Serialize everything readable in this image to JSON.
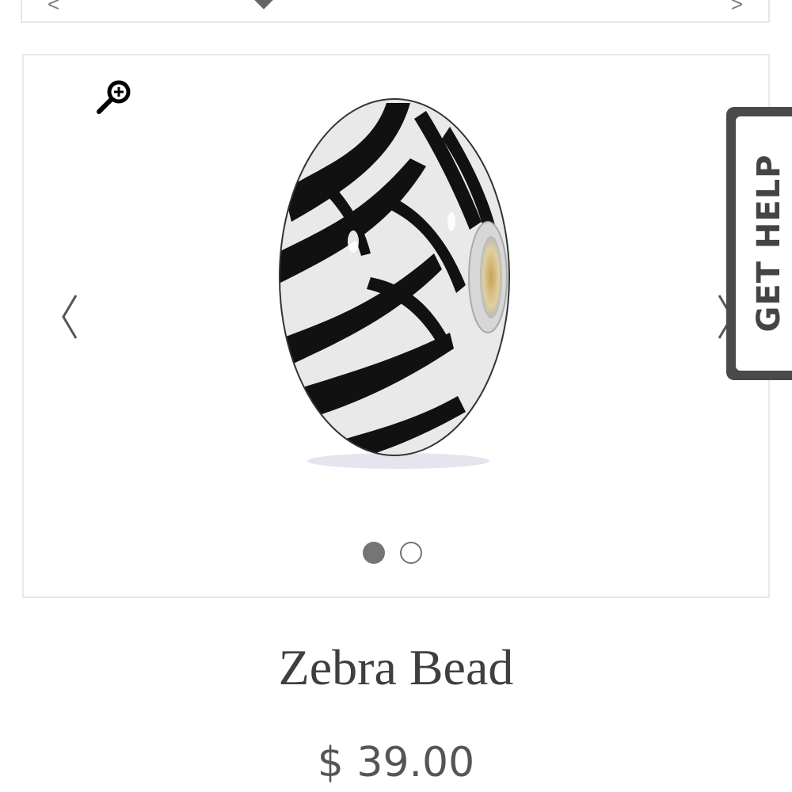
{
  "top_bar": {
    "chevron_left": "<",
    "chevron_right": ">",
    "icon": "diamond-icon"
  },
  "gallery": {
    "zoom_icon": "zoom-in-icon",
    "prev_icon": "chevron-left-icon",
    "next_icon": "chevron-right-icon",
    "slides_total": 2,
    "active_slide": 1
  },
  "help_tab": {
    "label": "GET HELP"
  },
  "product": {
    "title": "Zebra Bead",
    "price": "$ 39.00"
  },
  "colors": {
    "text_dark": "#3f3f3f",
    "border": "#e9e9e9",
    "dot": "#757575",
    "help_tab": "#4a4a4a"
  }
}
